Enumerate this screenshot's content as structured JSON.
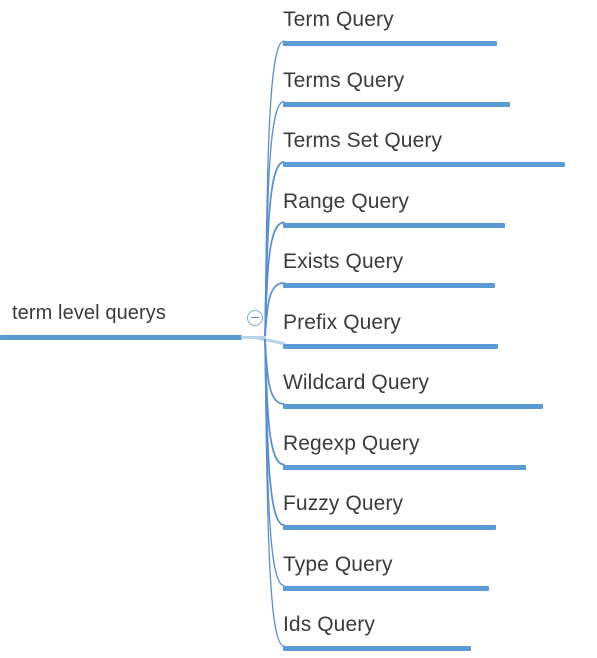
{
  "diagram": {
    "type": "mind-map",
    "title": "term level querys",
    "orientation": "left-root-right-children",
    "accent_color": "#5b9bd5",
    "text_color": "#3b3b3b",
    "background_color": "#ffffff"
  },
  "root": {
    "label": "term level querys",
    "toggle_icon": "minus-circle-icon",
    "toggle_state": "expanded"
  },
  "children": [
    {
      "label": "Term Query",
      "underline_width": 214
    },
    {
      "label": "Terms Query",
      "underline_width": 227
    },
    {
      "label": "Terms Set Query",
      "underline_width": 282
    },
    {
      "label": "Range Query",
      "underline_width": 222
    },
    {
      "label": "Exists Query",
      "underline_width": 212
    },
    {
      "label": "Prefix Query",
      "underline_width": 215
    },
    {
      "label": "Wildcard Query",
      "underline_width": 260
    },
    {
      "label": "Regexp Query",
      "underline_width": 243
    },
    {
      "label": "Fuzzy Query",
      "underline_width": 213
    },
    {
      "label": "Type Query",
      "underline_width": 206
    },
    {
      "label": "Ids Query",
      "underline_width": 188
    }
  ]
}
